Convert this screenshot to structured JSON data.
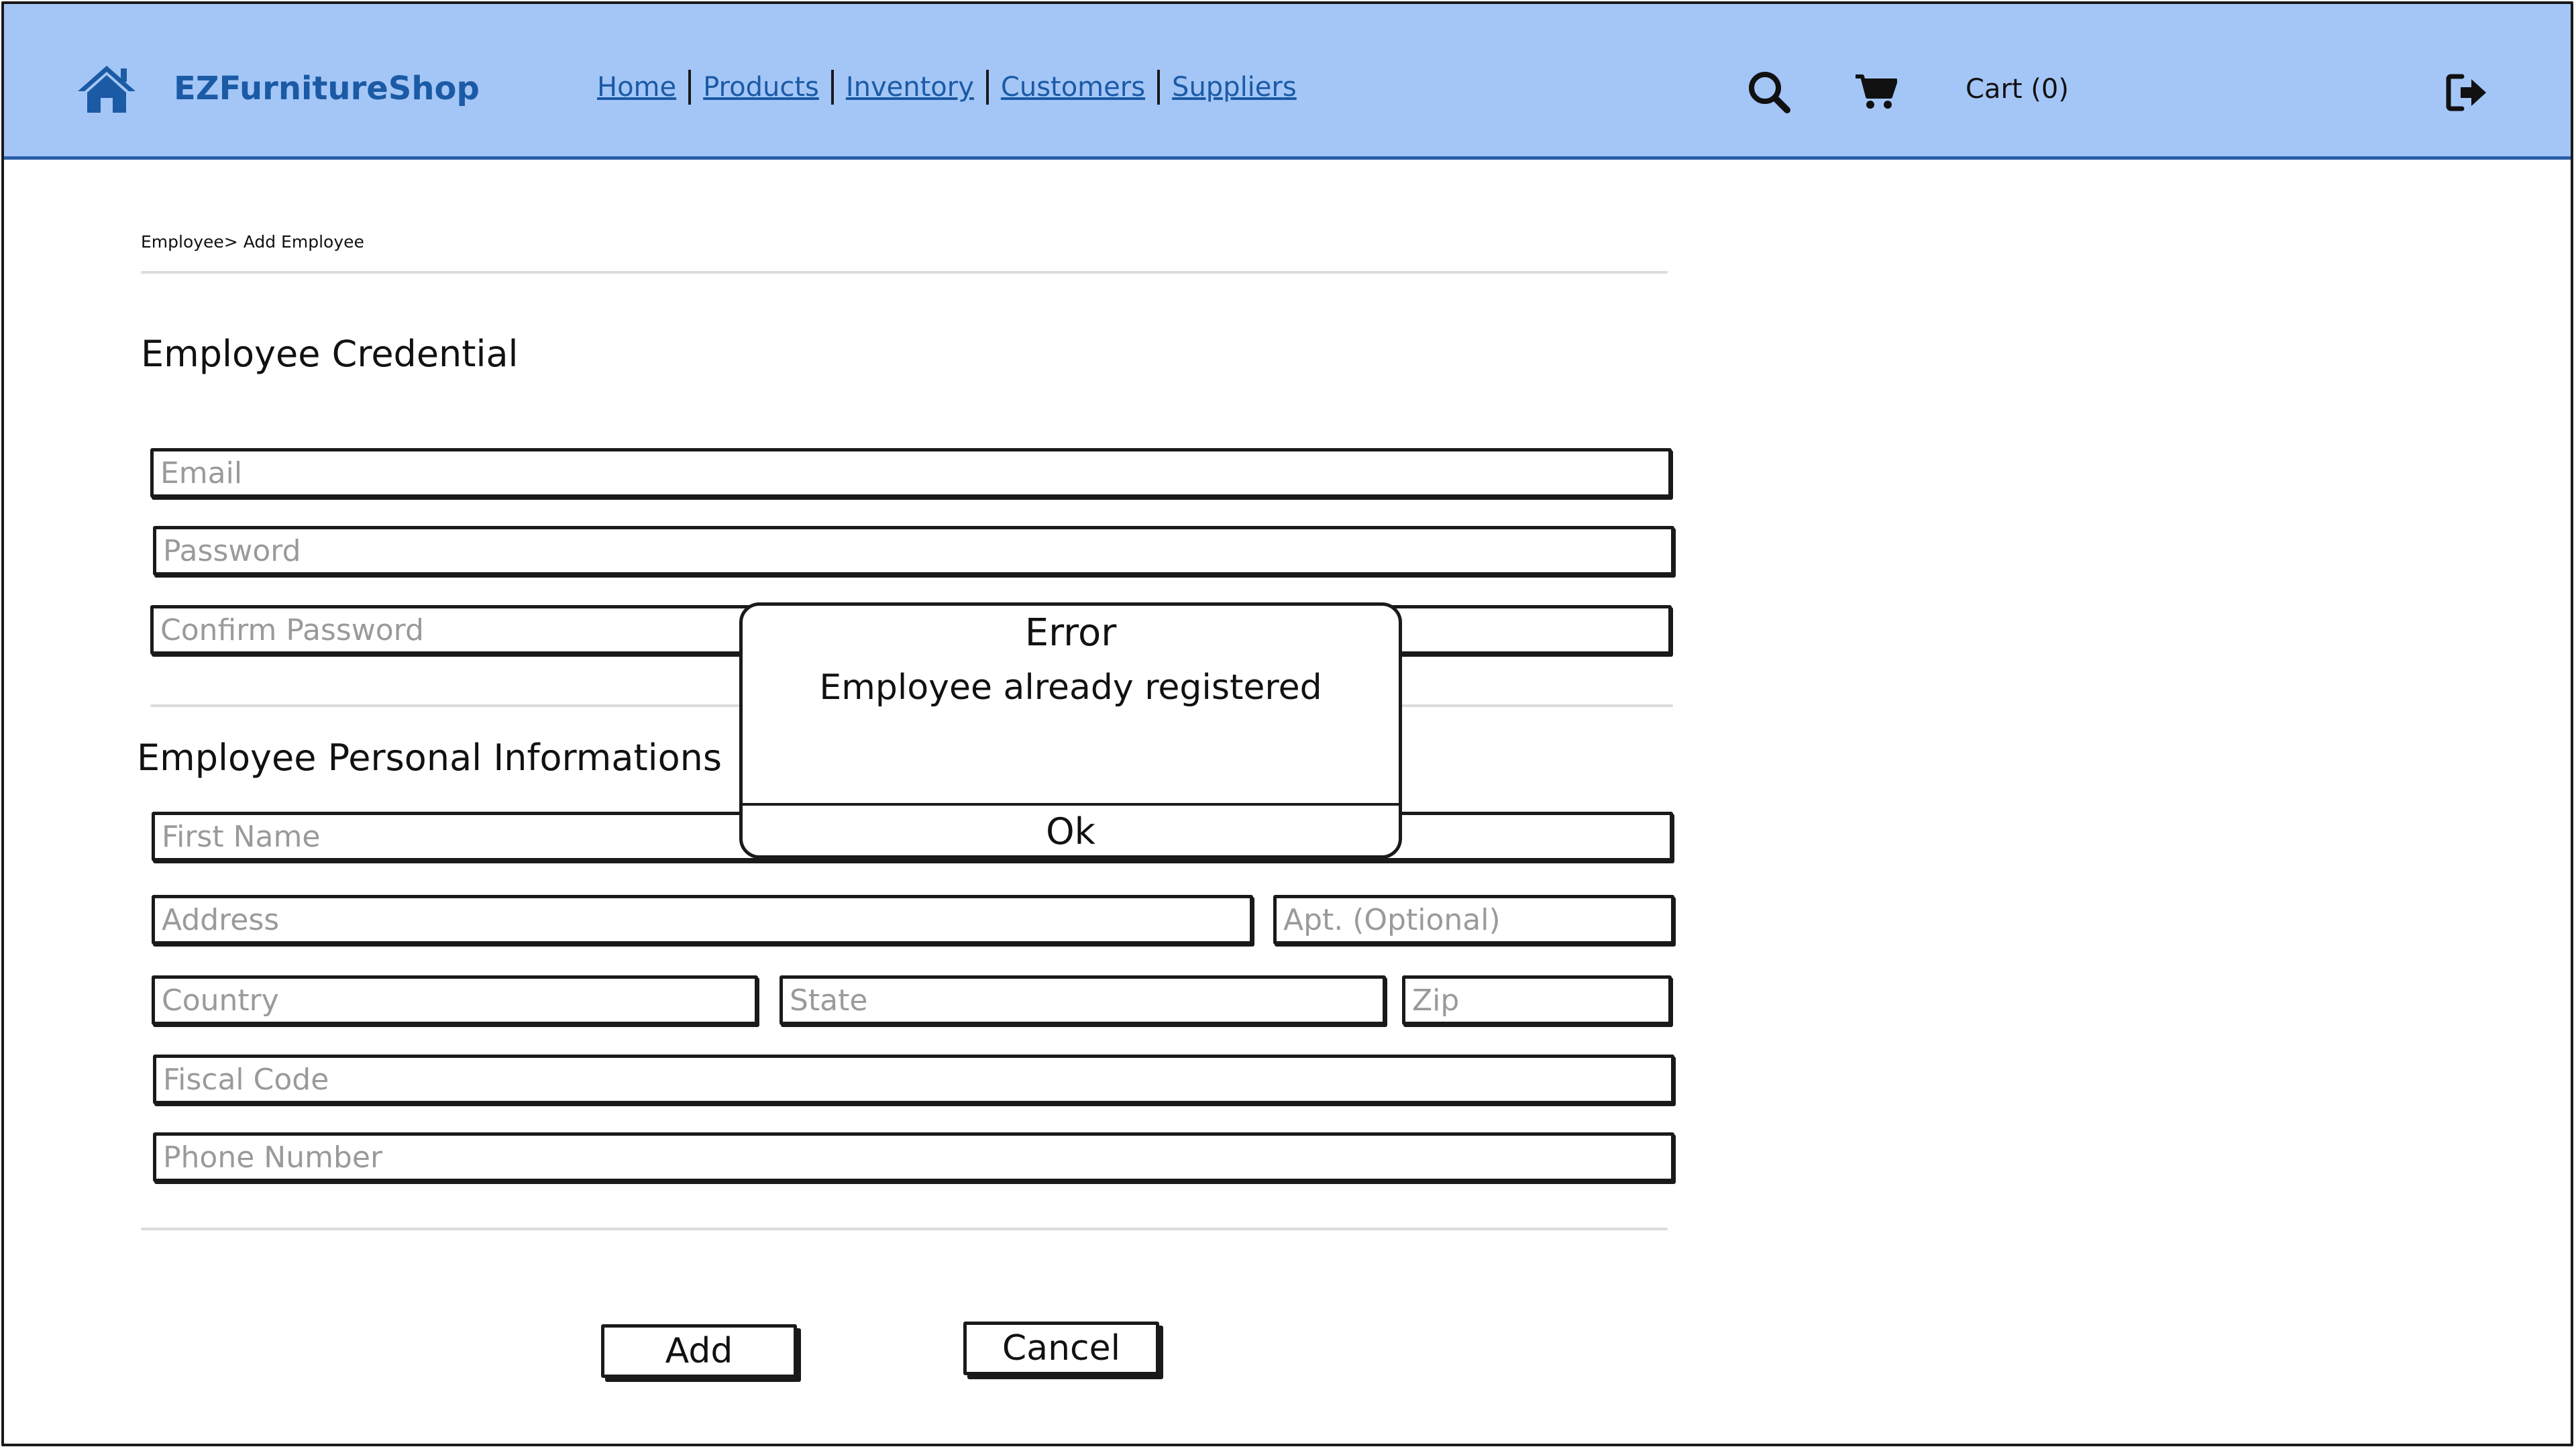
{
  "header": {
    "brand": "EZFurnitureShop",
    "nav": [
      {
        "label": "Home"
      },
      {
        "label": "Products"
      },
      {
        "label": "Inventory"
      },
      {
        "label": "Customers"
      },
      {
        "label": "Suppliers"
      }
    ],
    "cart_label": "Cart (0)",
    "icons": {
      "home": "home-icon",
      "search": "search-icon",
      "cart": "cart-icon",
      "logout": "logout-icon"
    },
    "colors": {
      "header_bg": "#a4c6f7",
      "brand": "#1b5aa5"
    }
  },
  "breadcrumb": "Employee> Add Employee",
  "credentials": {
    "title": "Employee Credential",
    "email_placeholder": "Email",
    "password_placeholder": "Password",
    "confirm_password_placeholder": "Confirm Password"
  },
  "personal": {
    "title": "Employee Personal Informations",
    "first_name_placeholder": "First Name",
    "address_placeholder": "Address",
    "apt_placeholder": "Apt. (Optional)",
    "country_placeholder": "Country",
    "state_placeholder": "State",
    "zip_placeholder": "Zip",
    "fiscal_code_placeholder": "Fiscal Code",
    "phone_placeholder": "Phone Number"
  },
  "actions": {
    "add_label": "Add",
    "cancel_label": "Cancel"
  },
  "dialog": {
    "title": "Error",
    "message": "Employee already registered",
    "ok_label": "Ok"
  }
}
